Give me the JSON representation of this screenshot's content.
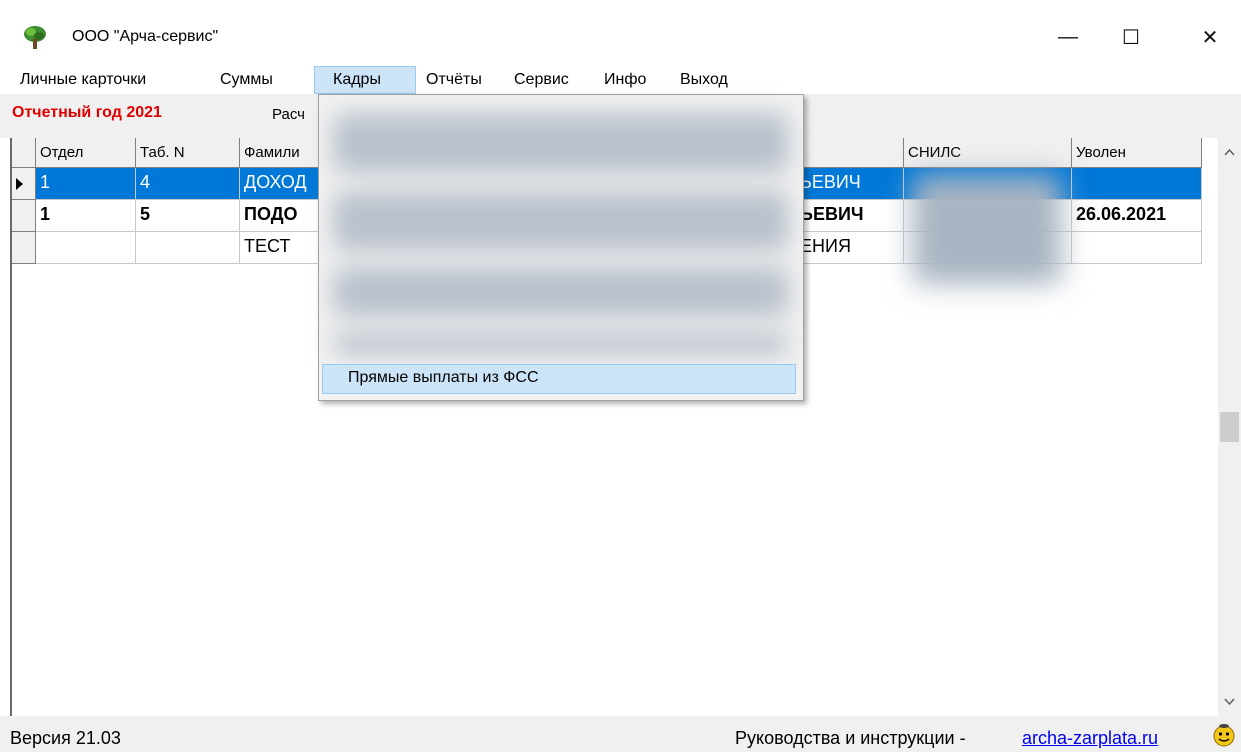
{
  "window": {
    "title": "ООО \"Арча-сервис\"",
    "minimize": "—",
    "maximize": "☐",
    "close": "✕"
  },
  "menu": {
    "items": [
      "Личные карточки",
      "Суммы",
      "Кадры",
      "Отчёты",
      "Сервис",
      "Инфо",
      "Выход"
    ],
    "active": "Кадры"
  },
  "toolbar": {
    "year_label": "Отчетный год 2021",
    "calc_label": "Расч"
  },
  "grid": {
    "columns": [
      "Отдел",
      "Таб. N",
      "Фамили",
      "СНИЛС",
      "Уволен"
    ],
    "rows": [
      {
        "dept": "1",
        "tab": "4",
        "surname": "ДОХОД",
        "patronymic": "ЬЕВИЧ",
        "fired": ""
      },
      {
        "dept": "1",
        "tab": "5",
        "surname": "ПОДО",
        "patronymic": "ЬЕВИЧ",
        "fired": "26.06.2021"
      },
      {
        "dept": "",
        "tab": "",
        "surname": "ТЕСТ",
        "patronymic": "ЕНИЯ",
        "fired": ""
      }
    ]
  },
  "dropdown": {
    "highlighted_item": "Прямые выплаты из ФСС"
  },
  "status": {
    "version": "Версия 21.03",
    "guide_label": "Руководства и инструкции - ",
    "guide_link": "archa-zarplata.ru"
  }
}
